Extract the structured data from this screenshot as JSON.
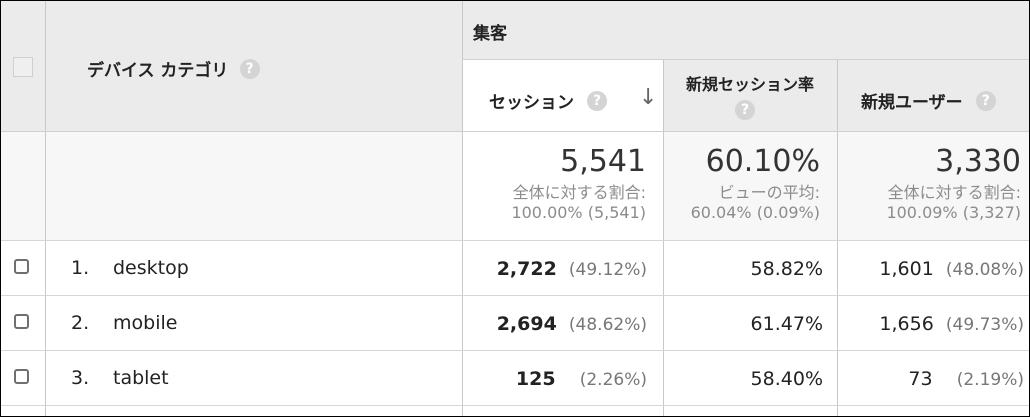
{
  "header": {
    "device_category_label": "デバイス カテゴリ",
    "group_label": "集客",
    "columns": [
      {
        "label": "セッション",
        "sort": "desc"
      },
      {
        "label": "新規セッション率"
      },
      {
        "label": "新規ユーザー"
      }
    ],
    "help_glyph": "?",
    "sort_glyph": "↓"
  },
  "summary": [
    {
      "value": "5,541",
      "line1": "全体に対する割合:",
      "line2": "100.00% (5,541)"
    },
    {
      "value": "60.10%",
      "line1": "ビューの平均:",
      "line2": "60.04% (0.09%)"
    },
    {
      "value": "3,330",
      "line1": "全体に対する割合:",
      "line2": "100.09% (3,327)"
    }
  ],
  "rows": [
    {
      "index": "1.",
      "name": "desktop",
      "sessions": "2,722",
      "sessions_pct": "(49.12%)",
      "new_rate": "58.82%",
      "new_users": "1,601",
      "new_users_pct": "(48.08%)"
    },
    {
      "index": "2.",
      "name": "mobile",
      "sessions": "2,694",
      "sessions_pct": "(48.62%)",
      "new_rate": "61.47%",
      "new_users": "1,656",
      "new_users_pct": "(49.73%)"
    },
    {
      "index": "3.",
      "name": "tablet",
      "sessions": "125",
      "sessions_pct": "(2.26%)",
      "new_rate": "58.40%",
      "new_users": "73",
      "new_users_pct": "(2.19%)"
    }
  ],
  "colors": {
    "header_bg": "#ebebeb",
    "summary_bg": "#f7f7f7"
  }
}
